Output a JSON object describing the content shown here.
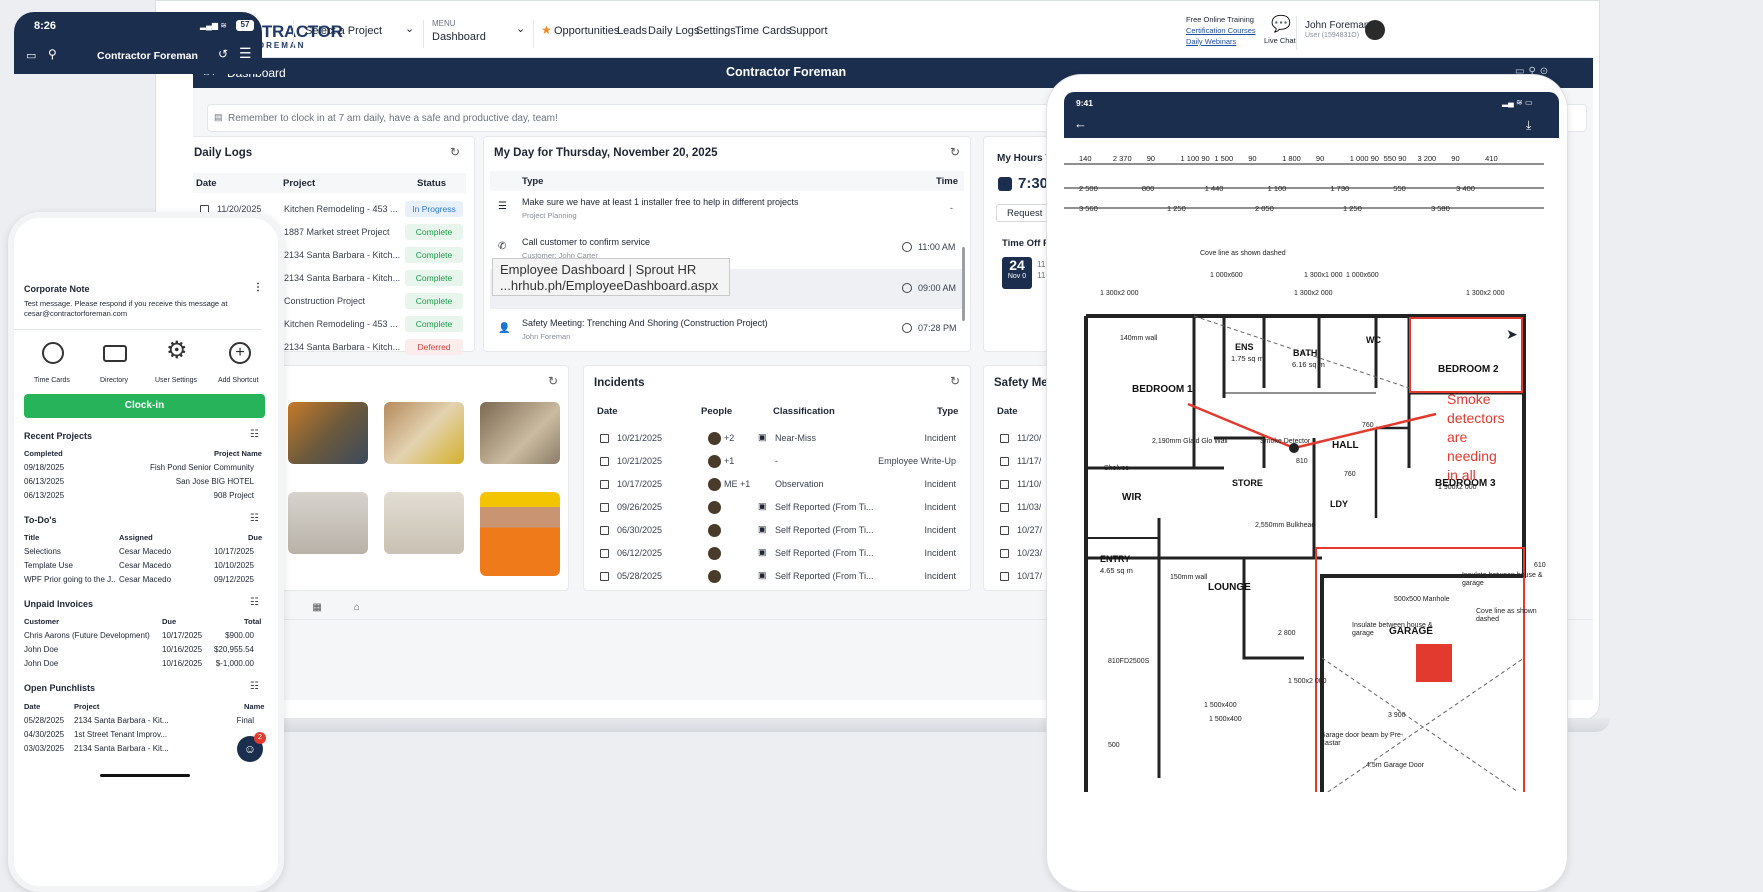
{
  "desktop": {
    "brand_main": "CONTRACTOR",
    "brand_sub": "FOREMAN",
    "project_select": "Select a Project",
    "menu_label": "MENU",
    "menu_value": "Dashboard",
    "nav_links": [
      "Opportunities",
      "Leads",
      "Daily Logs",
      "Settings",
      "Time Cards",
      "Support"
    ],
    "training": [
      "Free Online Training",
      "Certification Courses",
      "Daily Webinars"
    ],
    "live_chat": "Live Chat",
    "user_name": "John Foreman",
    "user_id": "User (1594831O)",
    "breadcrumb": "Dashboard",
    "header_title": "Contractor Foreman",
    "notice": "Remember to clock in at 7 am daily, have a safe and productive day, team!",
    "daily_logs": {
      "title": "Daily Logs",
      "columns": [
        "Date",
        "Project",
        "Status"
      ],
      "rows": [
        {
          "date": "11/20/2025",
          "project": "Kitchen Remodeling - 453 ...",
          "status": "In Progress"
        },
        {
          "date": "",
          "project": "1887 Market street Project",
          "status": "Complete"
        },
        {
          "date": "",
          "project": "2134 Santa Barbara - Kitch...",
          "status": "Complete"
        },
        {
          "date": "",
          "project": "2134 Santa Barbara - Kitch...",
          "status": "Complete"
        },
        {
          "date": "",
          "project": "Construction Project",
          "status": "Complete"
        },
        {
          "date": "",
          "project": "Kitchen Remodeling - 453 ...",
          "status": "Complete"
        },
        {
          "date": "",
          "project": "2134 Santa Barbara - Kitch...",
          "status": "Deferred"
        }
      ]
    },
    "my_day": {
      "title": "My Day for Thursday, November 20, 2025",
      "columns": [
        "Type",
        "Time"
      ],
      "rows": [
        {
          "title": "Make sure we have at least 1 installer free to help in different projects",
          "sub": "Project Planning",
          "time": "-"
        },
        {
          "title": "Call customer to confirm service",
          "sub": "Customer: John Carter",
          "time": "11:00 AM"
        },
        {
          "title": "",
          "sub": "",
          "time": "09:00 AM"
        },
        {
          "title": "Safety Meeting: Trenching And Shoring (Construction Project)",
          "sub": "John Foreman",
          "time": "07:28 PM"
        }
      ]
    },
    "tooltip": [
      "Employee Dashboard | Sprout HR",
      "...hrhub.ph/EmployeeDashboard.aspx"
    ],
    "my_hours": {
      "title": "My Hours T",
      "time": "7:30",
      "request": "Request",
      "time_off": "Time Off R",
      "day": "24",
      "month": "Nov",
      "extra": "0",
      "side1": "11",
      "side2": "11"
    },
    "incidents": {
      "title": "Incidents",
      "columns": [
        "Date",
        "People",
        "Classification",
        "Type"
      ],
      "rows": [
        {
          "date": "10/21/2025",
          "people": "+2",
          "class": "Near-Miss",
          "type": "Incident"
        },
        {
          "date": "10/21/2025",
          "people": "+1",
          "class": "-",
          "type": "Employee Write-Up"
        },
        {
          "date": "10/17/2025",
          "people": "ME +1",
          "class": "Observation",
          "type": "Incident"
        },
        {
          "date": "09/26/2025",
          "people": "",
          "class": "Self Reported (From Ti...",
          "type": "Incident"
        },
        {
          "date": "06/30/2025",
          "people": "",
          "class": "Self Reported (From Ti...",
          "type": "Incident"
        },
        {
          "date": "06/12/2025",
          "people": "",
          "class": "Self Reported (From Ti...",
          "type": "Incident"
        },
        {
          "date": "05/28/2025",
          "people": "",
          "class": "Self Reported (From Ti...",
          "type": "Incident"
        }
      ]
    },
    "safety": {
      "title": "Safety Mee",
      "col": "Date",
      "dates": [
        "11/20/",
        "11/17/",
        "11/10/",
        "11/03/",
        "10/27/",
        "10/23/",
        "10/17/"
      ]
    }
  },
  "phone": {
    "time": "8:26",
    "battery": "57",
    "title": "Contractor Foreman",
    "note_title": "Corporate Note",
    "note_text": "Test message. Please respond if you receive this message at cesar@contractorforeman.com",
    "shortcuts": [
      "Time Cards",
      "Directory",
      "User Settings",
      "Add Shortcut"
    ],
    "clock_in": "Clock-in",
    "recent": {
      "title": "Recent Projects",
      "h1": "Completed",
      "h2": "Project Name",
      "rows": [
        [
          "09/18/2025",
          "Fish Pond Senior Community"
        ],
        [
          "06/13/2025",
          "San Jose BIG HOTEL"
        ],
        [
          "06/13/2025",
          "908 Project"
        ]
      ]
    },
    "todos": {
      "title": "To-Do's",
      "h": [
        "Title",
        "Assigned",
        "Due"
      ],
      "rows": [
        [
          "Selections",
          "Cesar Macedo",
          "10/17/2025"
        ],
        [
          "Template Use",
          "Cesar Macedo",
          "10/10/2025"
        ],
        [
          "WPF Prior going to the J...",
          "Cesar Macedo",
          "09/12/2025"
        ]
      ]
    },
    "invoices": {
      "title": "Unpaid Invoices",
      "h": [
        "Customer",
        "Due",
        "Total"
      ],
      "rows": [
        [
          "Chris Aarons (Future Development)",
          "10/17/2025",
          "$900.00"
        ],
        [
          "John Doe",
          "10/16/2025",
          "$20,955.54"
        ],
        [
          "John Doe",
          "10/16/2025",
          "$-1,000.00"
        ]
      ]
    },
    "punch": {
      "title": "Open Punchlists",
      "h": [
        "Date",
        "Project",
        "Name"
      ],
      "rows": [
        [
          "05/28/2025",
          "2134 Santa Barbara - Kit...",
          "Final"
        ],
        [
          "04/30/2025",
          "1st Street Tenant Improv...",
          ""
        ],
        [
          "03/03/2025",
          "2134 Santa Barbara - Kit...",
          ""
        ]
      ]
    },
    "chat_badge": "2"
  },
  "tablet": {
    "time": "9:41",
    "dims_row1": [
      "140",
      "2 370",
      "90",
      "1 100 90",
      "1 500",
      "90",
      "1 800",
      "90",
      "1 000 90",
      "550 90",
      "3 200",
      "90",
      "410"
    ],
    "dims_row2": [
      "2 500",
      "800",
      "1 440",
      "1 100",
      "1 730",
      "550",
      "3 400"
    ],
    "dims_row3": [
      "3 560",
      "1 250",
      "2 050",
      "1 250",
      "3 580"
    ],
    "rooms": {
      "bed1": "BEDROOM 1",
      "bed2": "BEDROOM 2",
      "bed3": "BEDROOM 3",
      "ens": "ENS",
      "ens_area": "1.75 sq m",
      "bath": "BATH",
      "bath_area": "6.16 sq m",
      "wc": "WC",
      "hall": "HALL",
      "wir": "WIR",
      "store": "STORE",
      "ldy": "LDY",
      "entry": "ENTRY",
      "entry_area": "4.65 sq m",
      "lounge": "LOUNGE",
      "garage": "GARAGE"
    },
    "labels": [
      "Cove line as shown dashed",
      "1 000x600",
      "1 300x1 000",
      "1 000x600",
      "1 300x2 000",
      "1 300x2 000",
      "1 300x2 000",
      "140mm wall",
      "2,190mm Glaid Glo Wall",
      "Smoke Detector",
      "Shelves",
      "2,550mm Bulkhead",
      "150mm wall",
      "1 500x2 000",
      "1 500x400",
      "1 500x400",
      "810FD2500S",
      "Insulate between house & garage",
      "Cove line as shown dashed",
      "Insulate between house & garage",
      "500x500 Manhole",
      "Garage door beam by Pre-Castar",
      "4.5m Garage Door",
      "1 900x2 000",
      "610",
      "810",
      "760",
      "760",
      "500",
      "2 800",
      "3 900"
    ],
    "annotation": [
      "Smoke",
      "detectors",
      "are",
      "needing",
      "in all"
    ]
  },
  "colors": {
    "navy": "#1c2e4e",
    "green": "#27b35a",
    "red": "#e23a2e",
    "orange": "#f08a24"
  }
}
